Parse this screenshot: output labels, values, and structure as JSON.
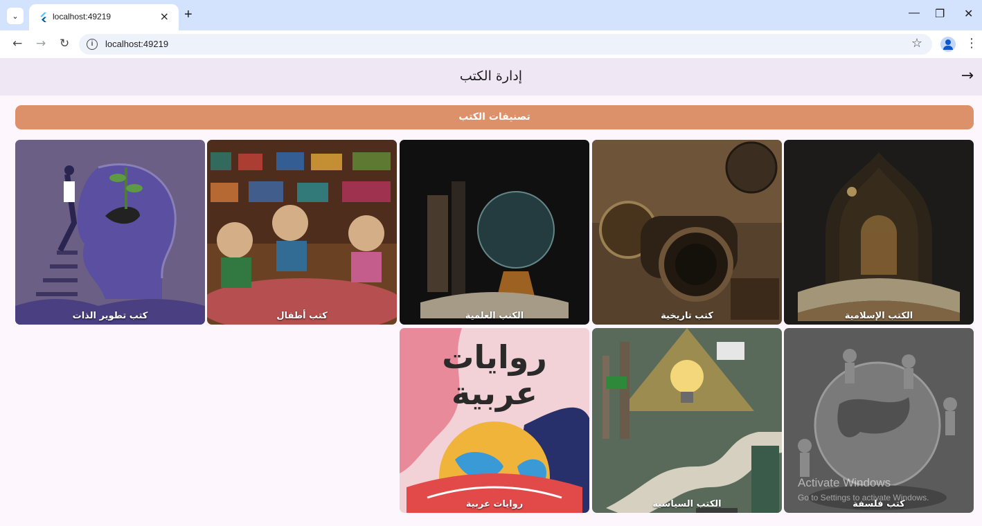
{
  "browser": {
    "tab_title": "localhost:49219",
    "url": "localhost:49219",
    "new_tab": "+",
    "tab_close": "×",
    "minimize": "—",
    "restore": "❐",
    "close": "✕"
  },
  "app": {
    "title": "إدارة الكتب",
    "section_title": "تصنيفات الكتب",
    "accent_color": "#dc916a"
  },
  "categories": [
    {
      "label": "الكتب الإسلامية",
      "icon": "islamic-books-image"
    },
    {
      "label": "كتب تاريخية",
      "icon": "history-books-image"
    },
    {
      "label": "الكتب العلمية",
      "icon": "science-books-image"
    },
    {
      "label": "كتب أطفال",
      "icon": "children-books-image"
    },
    {
      "label": "كتب تطوير الذات",
      "icon": "self-development-image"
    },
    {
      "label": "كتب فلسفة",
      "icon": "philosophy-books-image"
    },
    {
      "label": "الكتب السياسية",
      "icon": "political-books-image"
    },
    {
      "label": "روايات عربية",
      "icon": "arabic-novels-image"
    }
  ],
  "cover_text": {
    "novels_line1": "روايات",
    "novels_line2": "عربية"
  },
  "watermark": {
    "line1": "Activate Windows",
    "line2": "Go to Settings to activate Windows."
  }
}
